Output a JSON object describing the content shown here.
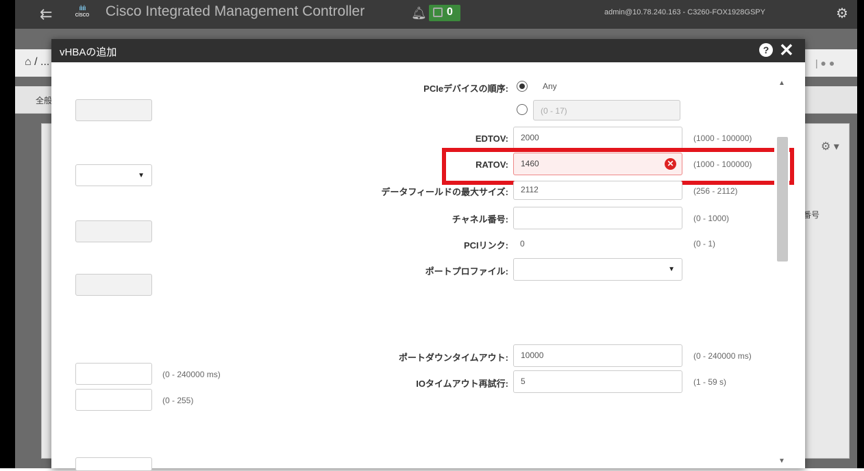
{
  "app": {
    "title": "Cisco Integrated Management Controller",
    "logo_text": "cisco",
    "alert_count": "0",
    "user_info": "admin@10.78.240.163 - C3260-FOX1928GSPY",
    "breadcrumb": "/ ...",
    "tab_label": "全般",
    "right_column_text": "番号"
  },
  "dialog": {
    "title": "vHBAの追加",
    "fields": {
      "pcie_order": {
        "label": "PCIeデバイスの順序:",
        "option_any": "Any",
        "option_range_placeholder": "(0 - 17)"
      },
      "edtov": {
        "label": "EDTOV:",
        "value": "2000",
        "range": "(1000 - 100000)"
      },
      "ratov": {
        "label": "RATOV:",
        "value": "1460",
        "range": "(1000 - 100000)"
      },
      "max_data_field": {
        "label": "データフィールドの最大サイズ:",
        "value": "2112",
        "range": "(256 - 2112)"
      },
      "channel_number": {
        "label": "チャネル番号:",
        "value": "",
        "range": "(0 - 1000)"
      },
      "pci_link": {
        "label": "PCIリンク:",
        "value": "0",
        "range": "(0 - 1)"
      },
      "port_profile": {
        "label": "ポートプロファイル:",
        "value": ""
      },
      "port_down_timeout": {
        "label": "ポートダウンタイムアウト:",
        "value": "10000",
        "range": "(0 - 240000 ms)"
      },
      "io_timeout_retry": {
        "label": "IOタイムアウト再試行:",
        "value": "5",
        "range": "(1 - 59 s)"
      }
    },
    "left_column": {
      "range_1": "(0 - 240000 ms)",
      "range_2": "(0 - 255)"
    }
  },
  "icons": [
    "collapse-nav-icon",
    "bell-icon",
    "gear-icon",
    "help-icon",
    "close-icon",
    "error-icon",
    "dropdown-caret-icon",
    "home-icon"
  ],
  "colors": {
    "highlight": "#e3151c",
    "header": "#303030",
    "alert_badge": "#3c8a3c",
    "error_bg": "#fdeeee"
  }
}
